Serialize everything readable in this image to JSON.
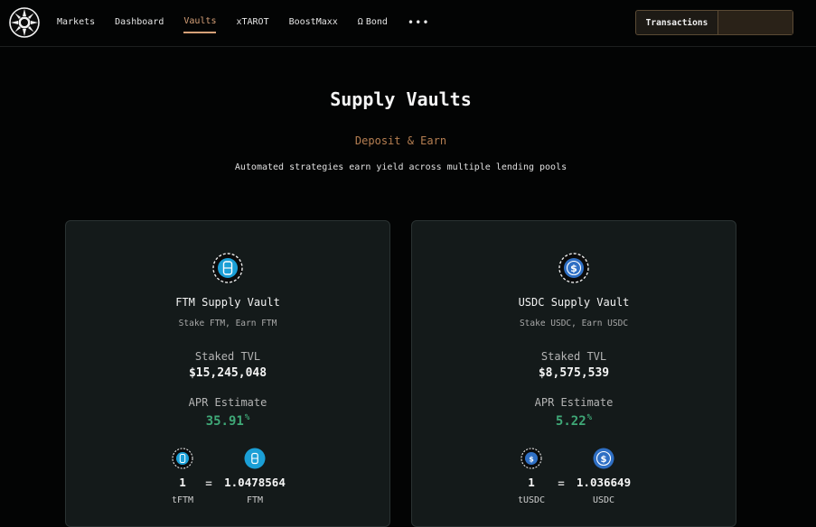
{
  "nav": {
    "items": [
      {
        "label": "Markets",
        "active": false
      },
      {
        "label": "Dashboard",
        "active": false
      },
      {
        "label": "Vaults",
        "active": true
      },
      {
        "label": "xTAROT",
        "active": false
      },
      {
        "label": "BoostMaxx",
        "active": false
      },
      {
        "label": "Bond",
        "icon": "omega-icon",
        "active": false
      }
    ],
    "more_label": "•••"
  },
  "header": {
    "transactions_label": "Transactions"
  },
  "hero": {
    "title": "Supply Vaults",
    "subtitle": "Deposit & Earn",
    "description": "Automated strategies earn yield across multiple lending pools"
  },
  "vaults": [
    {
      "title": "FTM Supply Vault",
      "subtitle": "Stake FTM, Earn FTM",
      "tvl_label": "Staked TVL",
      "tvl_value": "$15,245,048",
      "apr_label": "APR Estimate",
      "apr_value": "35.91",
      "apr_unit": "%",
      "exchange": {
        "left_amount": "1",
        "equals": "=",
        "right_amount": "1.0478564",
        "left_token": "tFTM",
        "right_token": "FTM"
      },
      "icon": "ftm-icon",
      "accent": "#1b9fd6"
    },
    {
      "title": "USDC Supply Vault",
      "subtitle": "Stake USDC, Earn USDC",
      "tvl_label": "Staked TVL",
      "tvl_value": "$8,575,539",
      "apr_label": "APR Estimate",
      "apr_value": "5.22",
      "apr_unit": "%",
      "exchange": {
        "left_amount": "1",
        "equals": "=",
        "right_amount": "1.036649",
        "left_token": "tUSDC",
        "right_token": "USDC"
      },
      "icon": "usdc-icon",
      "accent": "#2f6fc4"
    }
  ],
  "colors": {
    "accent": "#d6a078",
    "apr_green": "#3fa877",
    "card_bg": "#141a1a",
    "page_bg": "#030404"
  }
}
